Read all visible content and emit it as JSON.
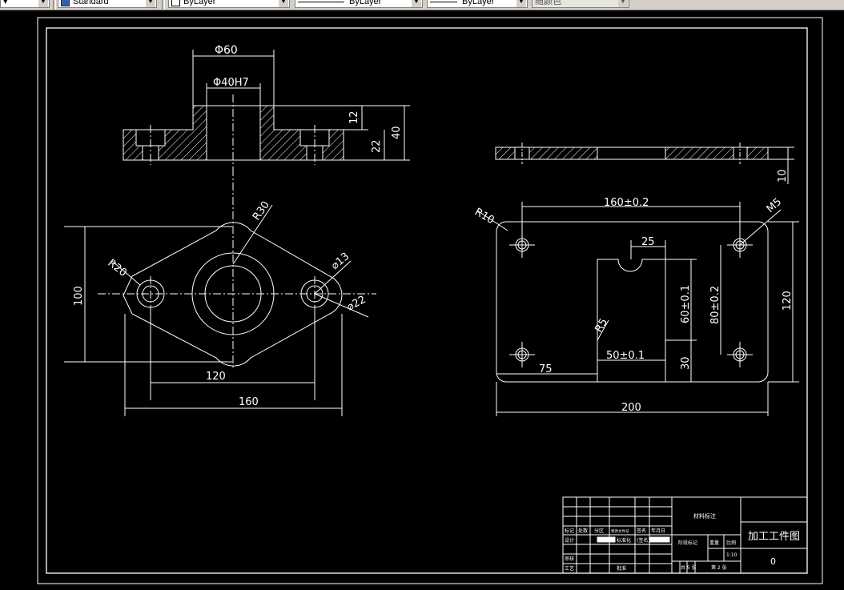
{
  "toolbar": {
    "layer_arrow": "▾",
    "text_style": "Standard",
    "layer": "ByLayer",
    "linetype": "ByLayer",
    "lineweight": "ByLayer",
    "color": "随颜色"
  },
  "drawing": {
    "front_view": {
      "dia_outer": "Φ60",
      "dia_bore": "Φ40H7",
      "dim_12": "12",
      "dim_22": "22",
      "dim_40": "40"
    },
    "top_view": {
      "r30": "R30",
      "r20": "R20",
      "hole13": "⌀13",
      "hole22": "⌀22",
      "dim_100": "100",
      "dim_120": "120",
      "dim_160": "160"
    },
    "side_view": {
      "dim_10": "10"
    },
    "plate_view": {
      "r10": "R10",
      "m5": "M5",
      "dim_160_tol": "160±0.2",
      "dim_25": "25",
      "r5": "R5",
      "dim_60_tol": "60±0.1",
      "dim_80_tol": "80±0.2",
      "dim_120": "120",
      "dim_50_tol": "50±0.1",
      "dim_30": "30",
      "dim_75": "75",
      "dim_200": "200"
    }
  },
  "title_block": {
    "material_label": "材料标注",
    "drawing_title": "加工工件图",
    "drawing_number": "0",
    "row_labels": [
      "标记",
      "处数",
      "分区",
      "更改文件号",
      "签名",
      "年月日"
    ],
    "design": "设计",
    "standardize": "标准化",
    "approve_sign": "(签名)",
    "stage_mark": "阶段标记",
    "weight": "重量",
    "scale_label": "比例",
    "scale": "1:10",
    "audit": "审核",
    "process": "工艺",
    "approve": "批准",
    "total_sheets": "共 5 张",
    "sheet_no": "第 2 张"
  }
}
